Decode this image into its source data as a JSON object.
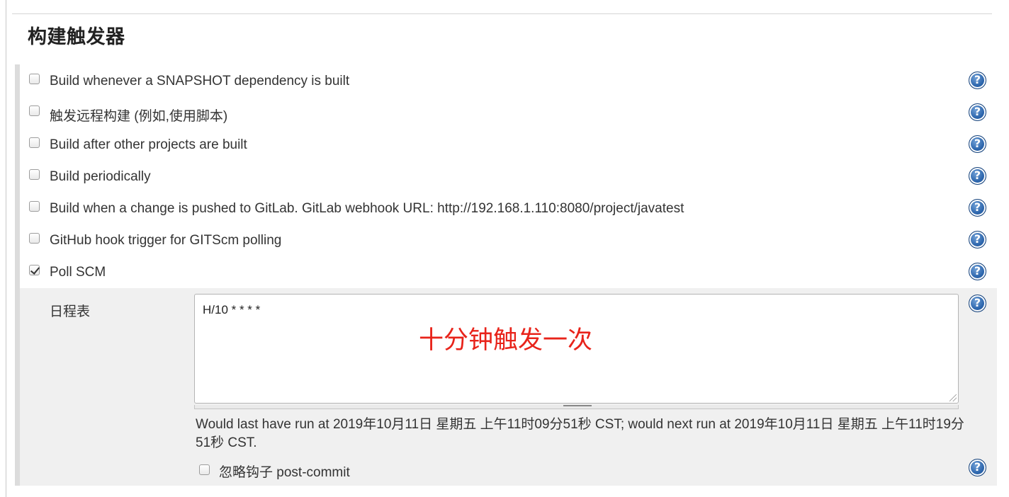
{
  "section": {
    "title": "构建触发器"
  },
  "triggers": [
    {
      "label": "Build whenever a SNAPSHOT dependency is built",
      "checked": false
    },
    {
      "label": "触发远程构建 (例如,使用脚本)",
      "checked": false
    },
    {
      "label": "Build after other projects are built",
      "checked": false
    },
    {
      "label": "Build periodically",
      "checked": false
    },
    {
      "label": "Build when a change is pushed to GitLab. GitLab webhook URL: http://192.168.1.110:8080/project/javatest",
      "checked": false
    },
    {
      "label": "GitHub hook trigger for GITScm polling",
      "checked": false
    },
    {
      "label": "Poll SCM",
      "checked": true
    }
  ],
  "poll_scm": {
    "schedule_label": "日程表",
    "schedule_value": "H/10 * * * *",
    "annotation": "十分钟触发一次",
    "annotation_color": "#e8231a",
    "run_info": "Would last have run at 2019年10月11日 星期五 上午11时09分51秒 CST; would next run at 2019年10月11日 星期五 上午11时19分51秒 CST.",
    "ignore_hook_label": "忽略钩子 post-commit",
    "ignore_hook_checked": false
  },
  "help": {
    "glyph": "?",
    "icon": "help-icon"
  }
}
